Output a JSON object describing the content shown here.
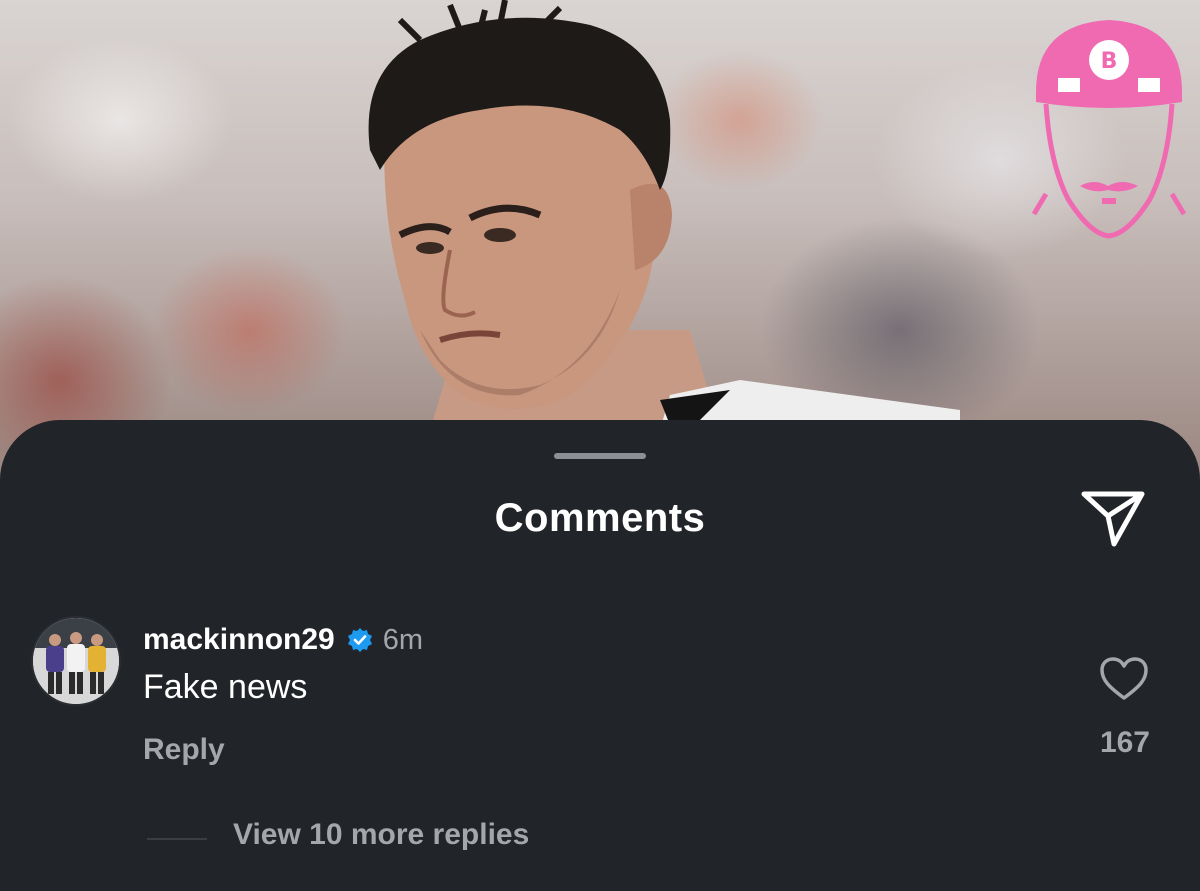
{
  "sheet": {
    "title": "Comments"
  },
  "comment": {
    "username": "mackinnon29",
    "verified": true,
    "time": "6m",
    "text": "Fake news",
    "reply_label": "Reply",
    "likes": "167",
    "view_replies_label": "View 10 more replies"
  },
  "colors": {
    "sheet_bg": "#212428",
    "verified_badge": "#1d9bf0",
    "logo_pink": "#f06ab2",
    "muted_text": "#a3a6aa"
  },
  "icons": {
    "share": "paper-plane-icon",
    "like": "heart-outline-icon",
    "verified": "verified-badge-icon",
    "logo": "barstool-helmet-logo"
  }
}
